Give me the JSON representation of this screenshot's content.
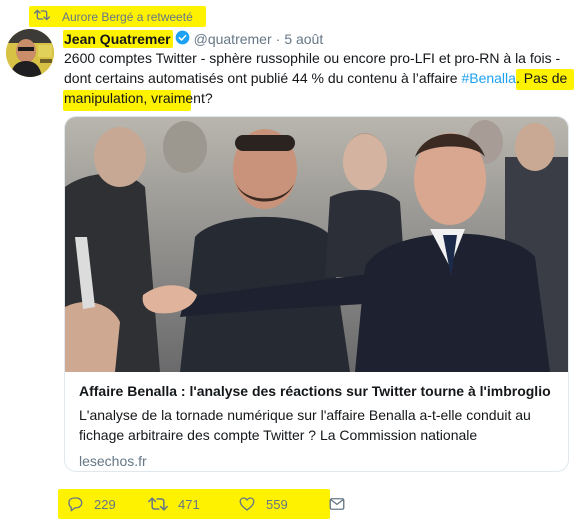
{
  "retweet": {
    "label": "Aurore Bergé a retweeté",
    "icon": "retweet-icon"
  },
  "tweet": {
    "author_name": "Jean Quatremer",
    "verified_icon": "verified-badge-icon",
    "handle": "@quatremer",
    "separator": "·",
    "date": "5 août",
    "text_before": "2600 comptes Twitter - sphère russophile ou encore pro-LFI et pro-RN à la fois - dont certains automatisés ont publié 44 % du contenu à l’affaire ",
    "hashtag": "#Benalla",
    "text_middle": ". ",
    "text_after": "Pas de manipulation, vraiment?"
  },
  "card": {
    "title": "Affaire Benalla : l'analyse des réactions sur Twitter tourne à l'imbroglio",
    "description": "L'analyse de la tornade numérique sur  l'affaire Benalla a-t-elle conduit au fichage arbitraire des compte Twitter ? La Commission nationale",
    "domain": "lesechos.fr"
  },
  "actions": {
    "reply_count": "229",
    "retweet_count": "471",
    "like_count": "559"
  },
  "colors": {
    "highlight": "#fff200",
    "link": "#1da1f2",
    "muted": "#657786",
    "verified": "#1da1f2"
  }
}
